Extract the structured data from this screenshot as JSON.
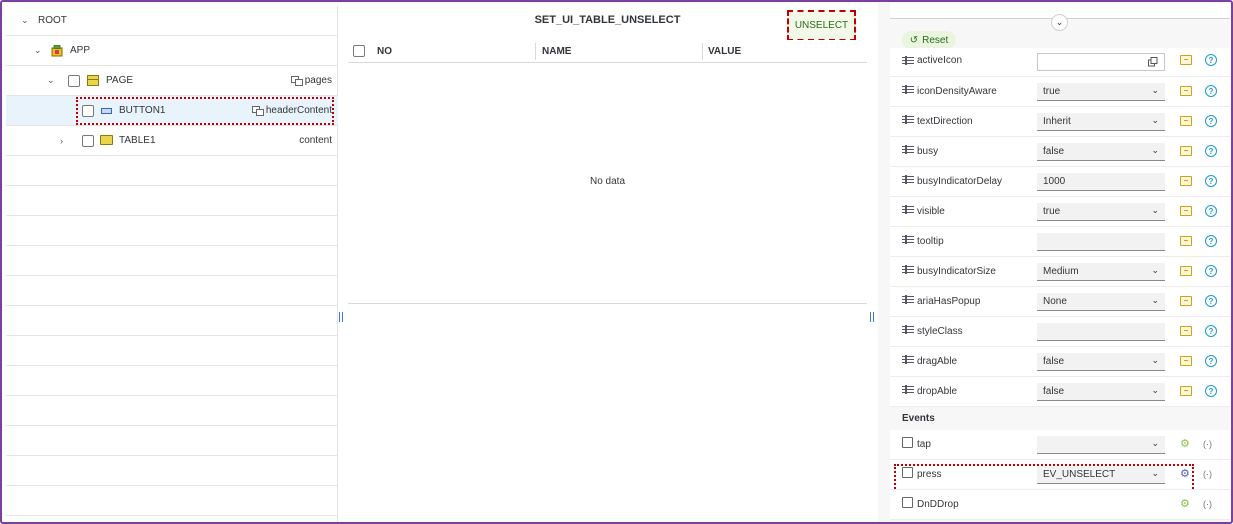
{
  "tree": {
    "rows": [
      {
        "label": "ROOT"
      },
      {
        "label": "APP"
      },
      {
        "label": "PAGE",
        "aggregation": "pages"
      },
      {
        "label": "BUTTON1",
        "aggregation": "headerContent"
      },
      {
        "label": "TABLE1",
        "aggregation": "content"
      }
    ]
  },
  "table": {
    "title": "SET_UI_TABLE_UNSELECT",
    "action_button": "UNSELECT",
    "columns": [
      "NO",
      "NAME",
      "VALUE"
    ],
    "empty_text": "No data"
  },
  "properties": {
    "reset_label": "Reset",
    "items": [
      {
        "label": "activeIcon",
        "value": ""
      },
      {
        "label": "iconDensityAware",
        "value": "true"
      },
      {
        "label": "textDirection",
        "value": "Inherit"
      },
      {
        "label": "busy",
        "value": "false"
      },
      {
        "label": "busyIndicatorDelay",
        "value": "1000"
      },
      {
        "label": "visible",
        "value": "true"
      },
      {
        "label": "tooltip",
        "value": ""
      },
      {
        "label": "busyIndicatorSize",
        "value": "Medium"
      },
      {
        "label": "ariaHasPopup",
        "value": "None"
      },
      {
        "label": "styleClass",
        "value": ""
      },
      {
        "label": "dragAble",
        "value": "false"
      },
      {
        "label": "dropAble",
        "value": "false"
      }
    ],
    "events_title": "Events",
    "events": [
      {
        "label": "tap",
        "value": ""
      },
      {
        "label": "press",
        "value": "EV_UNSELECT"
      },
      {
        "label": "DnDDrop",
        "value": ""
      }
    ]
  },
  "colors": {
    "frame": "#7b3fa0",
    "highlight": "#c00000",
    "selected_row": "#e8f3fb",
    "accent_blue": "#1b9ad6"
  }
}
